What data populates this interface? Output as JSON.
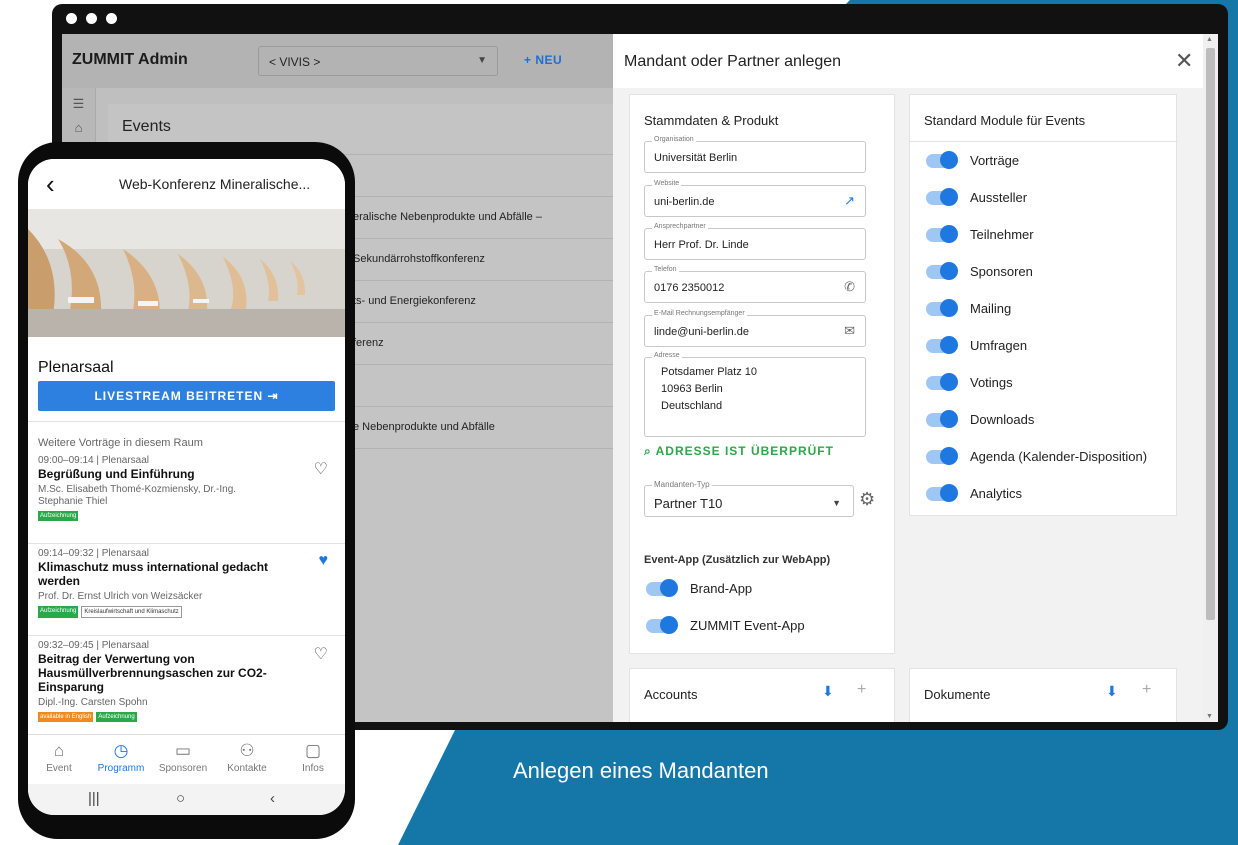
{
  "colors": {
    "background_blue": "#1577a8",
    "accent_blue": "#1f78e0",
    "verify_green": "#2aa84a"
  },
  "admin": {
    "brand": "ZUMMIT Admin",
    "selector": {
      "value": "< VIVIS >"
    },
    "new_button": "+ NEU",
    "events_title": "Events",
    "event_rows": [
      "",
      "eralische Nebenprodukte und Abfälle –",
      "Sekundärrohstoffkonferenz",
      "ts- und Energiekonferenz",
      "ferenz",
      "",
      "e Nebenprodukte und Abfälle"
    ]
  },
  "drawer": {
    "title": "Mandant oder Partner anlegen",
    "stamm": {
      "title": "Stammdaten & Produkt",
      "organisation": {
        "label": "Organisation",
        "value": "Universität Berlin"
      },
      "website": {
        "label": "Website",
        "value": "uni-berlin.de"
      },
      "ansprechpartner": {
        "label": "Ansprechpartner",
        "value": "Herr Prof. Dr. Linde"
      },
      "telefon": {
        "label": "Telefon",
        "value": "0176 2350012"
      },
      "email": {
        "label": "E-Mail Rechnungsempfänger",
        "value": "linde@uni-berlin.de"
      },
      "adresse": {
        "label": "Adresse",
        "line1": "Potsdamer Platz 10",
        "line2": "10963 Berlin",
        "line3": "Deutschland"
      },
      "verified": "ADRESSE IST ÜBERPRÜFT",
      "mandanten_typ": {
        "label": "Mandanten-Typ",
        "value": "Partner T10"
      },
      "event_app_title": "Event-App (Zusätzlich zur WebApp)",
      "apps": [
        "Brand-App",
        "ZUMMIT Event-App"
      ]
    },
    "module": {
      "title": "Standard Module für Events",
      "items": [
        "Vorträge",
        "Aussteller",
        "Teilnehmer",
        "Sponsoren",
        "Mailing",
        "Umfragen",
        "Votings",
        "Downloads",
        "Agenda (Kalender-Disposition)",
        "Analytics"
      ]
    },
    "accounts_title": "Accounts",
    "dokumente_title": "Dokumente"
  },
  "phone": {
    "title": "Web-Konferenz Mineralische...",
    "room": "Plenarsaal",
    "livestream": "LIVESTREAM BEITRETEN",
    "more_label": "Weitere Vorträge in diesem Raum",
    "talks": [
      {
        "time": "09:00–09:14 | Plenarsaal",
        "title": "Begrüßung und Einführung",
        "speaker": "M.Sc. Elisabeth Thomé-Kozmiensky, Dr.-Ing. Stephanie Thiel",
        "tags": [
          "Aufzeichnung"
        ],
        "favorite": false
      },
      {
        "time": "09:14–09:32 | Plenarsaal",
        "title": "Klimaschutz muss international gedacht werden",
        "speaker": "Prof. Dr. Ernst Ulrich von Weizsäcker",
        "tags": [
          "Aufzeichnung",
          "Kreislaufwirtschaft und Klimaschutz"
        ],
        "favorite": true
      },
      {
        "time": "09:32–09:45 | Plenarsaal",
        "title": "Beitrag der Verwertung von Hausmüllverbrennungsaschen zur CO2-Einsparung",
        "speaker": "Dipl.-Ing. Carsten Spohn",
        "tags": [
          "available in English",
          "Aufzeichnung"
        ],
        "favorite": false
      }
    ],
    "nav": [
      "Event",
      "Programm",
      "Sponsoren",
      "Kontakte",
      "Infos"
    ],
    "nav_active": "Programm"
  },
  "caption": "Anlegen eines Mandanten"
}
